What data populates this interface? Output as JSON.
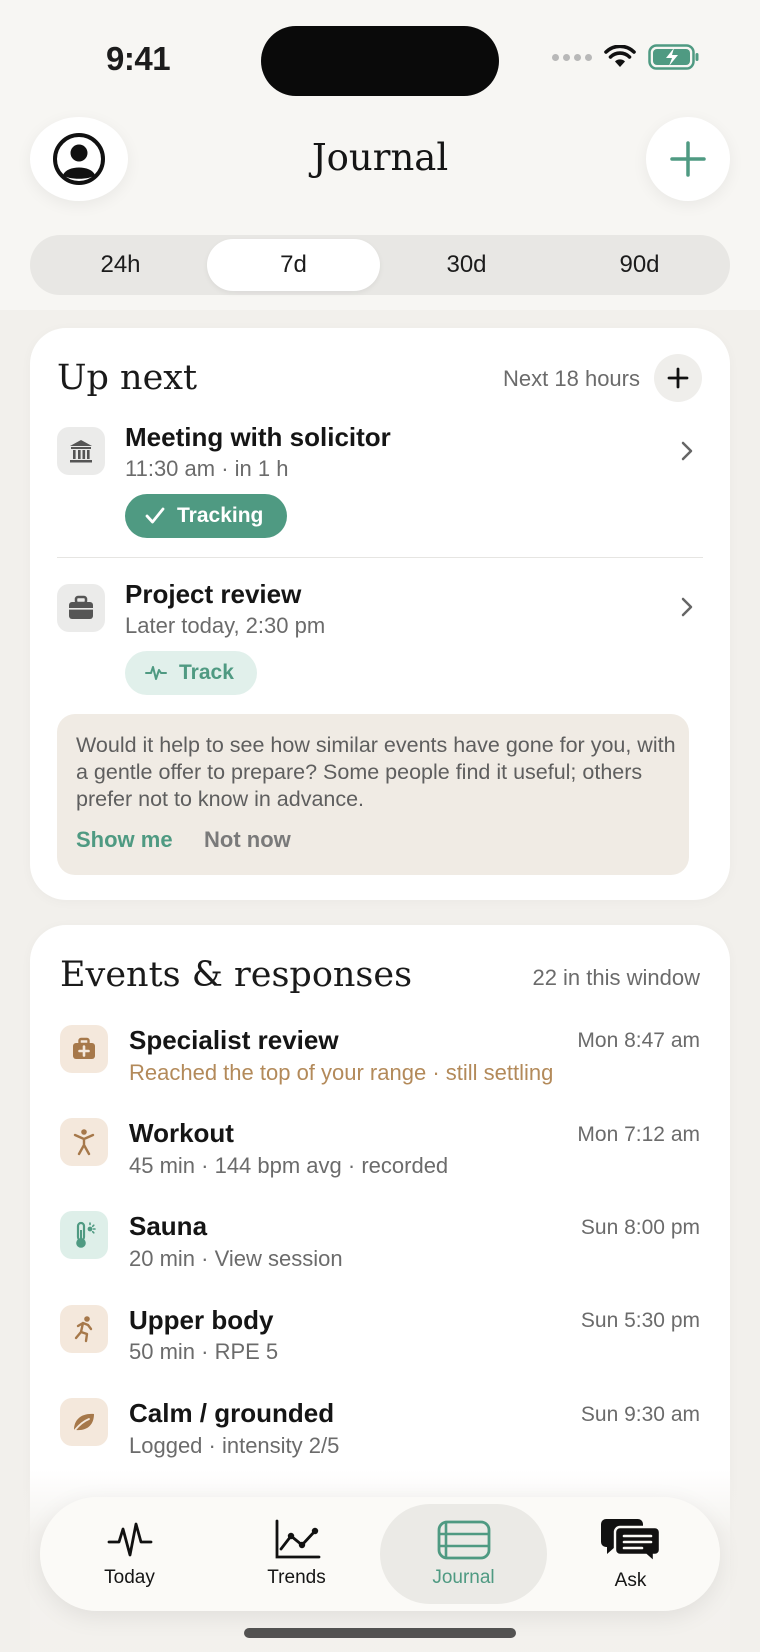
{
  "status_bar": {
    "time": "9:41"
  },
  "header": {
    "title": "Journal"
  },
  "range_tabs": [
    "24h",
    "7d",
    "30d",
    "90d"
  ],
  "range_selected": 1,
  "up_next": {
    "title": "Up next",
    "window": "Next 18 hours",
    "items": [
      {
        "title": "Meeting with solicitor",
        "subtitle": "11:30 am · in 1 h",
        "icon": "bank-icon",
        "action_label": "Tracking",
        "action_state": "tracking"
      },
      {
        "title": "Project review",
        "subtitle": "Later today, 2:30 pm",
        "icon": "briefcase-icon",
        "action_label": "Track",
        "action_state": "track"
      }
    ],
    "suggestion": {
      "text": "Would it help to see how similar events have gone for you, with a gentle offer to prepare? Some people find it useful; others prefer not to know in advance.",
      "primary": "Show me",
      "secondary": "Not now"
    }
  },
  "events": {
    "title": "Events & responses",
    "count_label": "22 in this window",
    "items": [
      {
        "title": "Specialist review",
        "subtitle": "Reached the top of your range · still settling",
        "time": "Mon 8:47 am",
        "icon": "medical-bag-icon",
        "highlight": true
      },
      {
        "title": "Workout",
        "subtitle": "45 min · 144 bpm avg · recorded",
        "time": "Mon 7:12 am",
        "icon": "figure-icon",
        "highlight": false
      },
      {
        "title": "Sauna",
        "subtitle": "20 min · View session",
        "time": "Sun 8:00 pm",
        "icon": "thermometer-icon",
        "highlight": false
      },
      {
        "title": "Upper body",
        "subtitle": "50 min · RPE 5",
        "time": "Sun 5:30 pm",
        "icon": "running-icon",
        "highlight": false
      },
      {
        "title": "Calm / grounded",
        "subtitle": "Logged · intensity 2/5",
        "time": "Sun 9:30 am",
        "icon": "leaf-icon",
        "highlight": false
      }
    ]
  },
  "tabbar": {
    "items": [
      {
        "label": "Today",
        "icon": "pulse-icon"
      },
      {
        "label": "Trends",
        "icon": "trend-chart-icon"
      },
      {
        "label": "Journal",
        "icon": "journal-icon"
      },
      {
        "label": "Ask",
        "icon": "chat-bubbles-icon"
      }
    ],
    "active": 2
  },
  "colors": {
    "accent": "#4f9a82",
    "warm": "#b38a5a",
    "background": "#f2f0ec"
  }
}
